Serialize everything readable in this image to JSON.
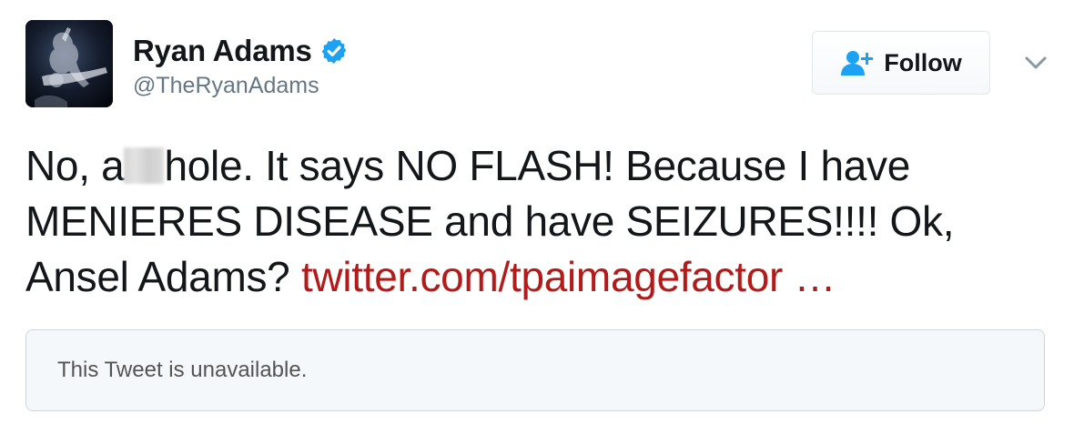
{
  "author": {
    "display_name": "Ryan Adams",
    "handle": "@TheRyanAdams",
    "verified": true
  },
  "actions": {
    "follow_label": "Follow"
  },
  "tweet": {
    "text_before_censor": "No, a",
    "text_after_censor": "hole. It says NO FLASH! Because I have MENIERES DISEASE and have SEIZURES!!!! Ok, Ansel Adams? ",
    "link_text": "twitter.com/tpaimagefactor …"
  },
  "quoted_tweet": {
    "message": "This Tweet is unavailable."
  },
  "colors": {
    "verified_blue": "#1da1f2",
    "link": "#b31b1b",
    "text": "#14171a",
    "secondary_text": "#657786"
  }
}
